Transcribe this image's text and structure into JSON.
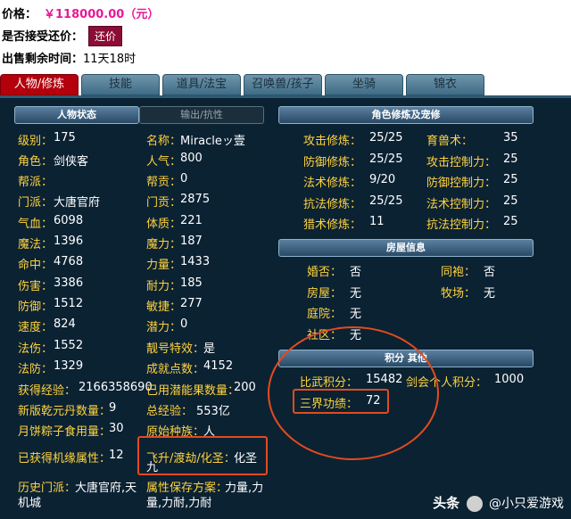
{
  "top": {
    "price_label": "价格：",
    "price_value": "￥118000.00（元）",
    "bargain_label": "是否接受还价：",
    "bargain_button": "还价",
    "time_label": "出售剩余时间：",
    "time_value": "11天18时"
  },
  "tabs": [
    "人物/修炼",
    "技能",
    "道具/法宝",
    "召唤兽/孩子",
    "坐骑",
    "锦衣"
  ],
  "left": {
    "header_active": "人物状态",
    "header_inactive": "输出/抗性",
    "rows": [
      [
        [
          "级别：",
          "175"
        ],
        [
          "名称：",
          "Miracleッ壹"
        ]
      ],
      [
        [
          "角色：",
          "剑侠客"
        ],
        [
          "人气：",
          "800"
        ]
      ],
      [
        [
          "帮派：",
          ""
        ],
        [
          "帮贡：",
          "0"
        ]
      ],
      [
        [
          "门派：",
          "大唐官府"
        ],
        [
          "门贡：",
          "2875"
        ]
      ],
      [
        [
          "气血：",
          "6098"
        ],
        [
          "体质：",
          "221"
        ]
      ],
      [
        [
          "魔法：",
          "1396"
        ],
        [
          "魔力：",
          "187"
        ]
      ],
      [
        [
          "命中：",
          "4768"
        ],
        [
          "力量：",
          "1433"
        ]
      ],
      [
        [
          "伤害：",
          "3386"
        ],
        [
          "耐力：",
          "185"
        ]
      ],
      [
        [
          "防御：",
          "1512"
        ],
        [
          "敏捷：",
          "277"
        ]
      ],
      [
        [
          "速度：",
          "824"
        ],
        [
          "潜力：",
          "0"
        ]
      ],
      [
        [
          "法伤：",
          "1552"
        ],
        [
          "靓号特效：",
          "是"
        ]
      ],
      [
        [
          "法防：",
          "1329"
        ],
        [
          "成就点数：",
          "4152"
        ]
      ],
      [
        [
          "获得经验：",
          "2166358690"
        ],
        [
          "已用潜能果数量：",
          "200"
        ]
      ],
      [
        [
          "新版乾元丹数量：",
          "9"
        ],
        [
          "总经验：",
          "553亿"
        ]
      ],
      [
        [
          "月饼粽子食用量：",
          "30"
        ],
        [
          "原始种族：",
          "人"
        ]
      ],
      [
        [
          "已获得机缘属性：",
          "12"
        ],
        [
          "飞升/渡劫/化圣：",
          "化圣"
        ]
      ],
      [
        [
          "历史门派：",
          "大唐官府,天"
        ],
        [
          "属性保存方案：",
          "力量,力"
        ]
      ]
    ],
    "wrap": {
      "ascend_cont": "九",
      "history_cont": "机城",
      "scheme_cont": "量,力耐,力耐"
    }
  },
  "right": {
    "cultivation_header": "角色修炼及宠修",
    "cultivation_rows": [
      [
        [
          "攻击修炼：",
          "25/25"
        ],
        [
          "育兽术：",
          "35"
        ]
      ],
      [
        [
          "防御修炼：",
          "25/25"
        ],
        [
          "攻击控制力：",
          "25"
        ]
      ],
      [
        [
          "法术修炼：",
          "9/20"
        ],
        [
          "防御控制力：",
          "25"
        ]
      ],
      [
        [
          "抗法修炼：",
          "25/25"
        ],
        [
          "法术控制力：",
          "25"
        ]
      ],
      [
        [
          "猎术修炼：",
          "11"
        ],
        [
          "抗法控制力：",
          "25"
        ]
      ]
    ],
    "house_header": "房屋信息",
    "house_rows": [
      [
        [
          "婚否：",
          "否"
        ],
        [
          "同袍：",
          "否"
        ]
      ],
      [
        [
          "房屋：",
          "无"
        ],
        [
          "牧场：",
          "无"
        ]
      ],
      [
        [
          "庭院：",
          "无"
        ]
      ],
      [
        [
          "社区：",
          "无"
        ]
      ]
    ],
    "points_header": "积分 其他",
    "points": {
      "pk_label": "比武积分：",
      "pk_value": "15482",
      "alliance_label": "剑会个人积分：",
      "alliance_value": "1000",
      "merit_label": "三界功绩：",
      "merit_value": "72"
    }
  },
  "watermark": {
    "brand": "头条",
    "account": "@小只爱游戏"
  },
  "colors": {
    "accent": "#b4000c",
    "price": "#e8189a",
    "label": "#ffd33d",
    "highlight": "#e34b1e",
    "panel": "#0b2233"
  }
}
